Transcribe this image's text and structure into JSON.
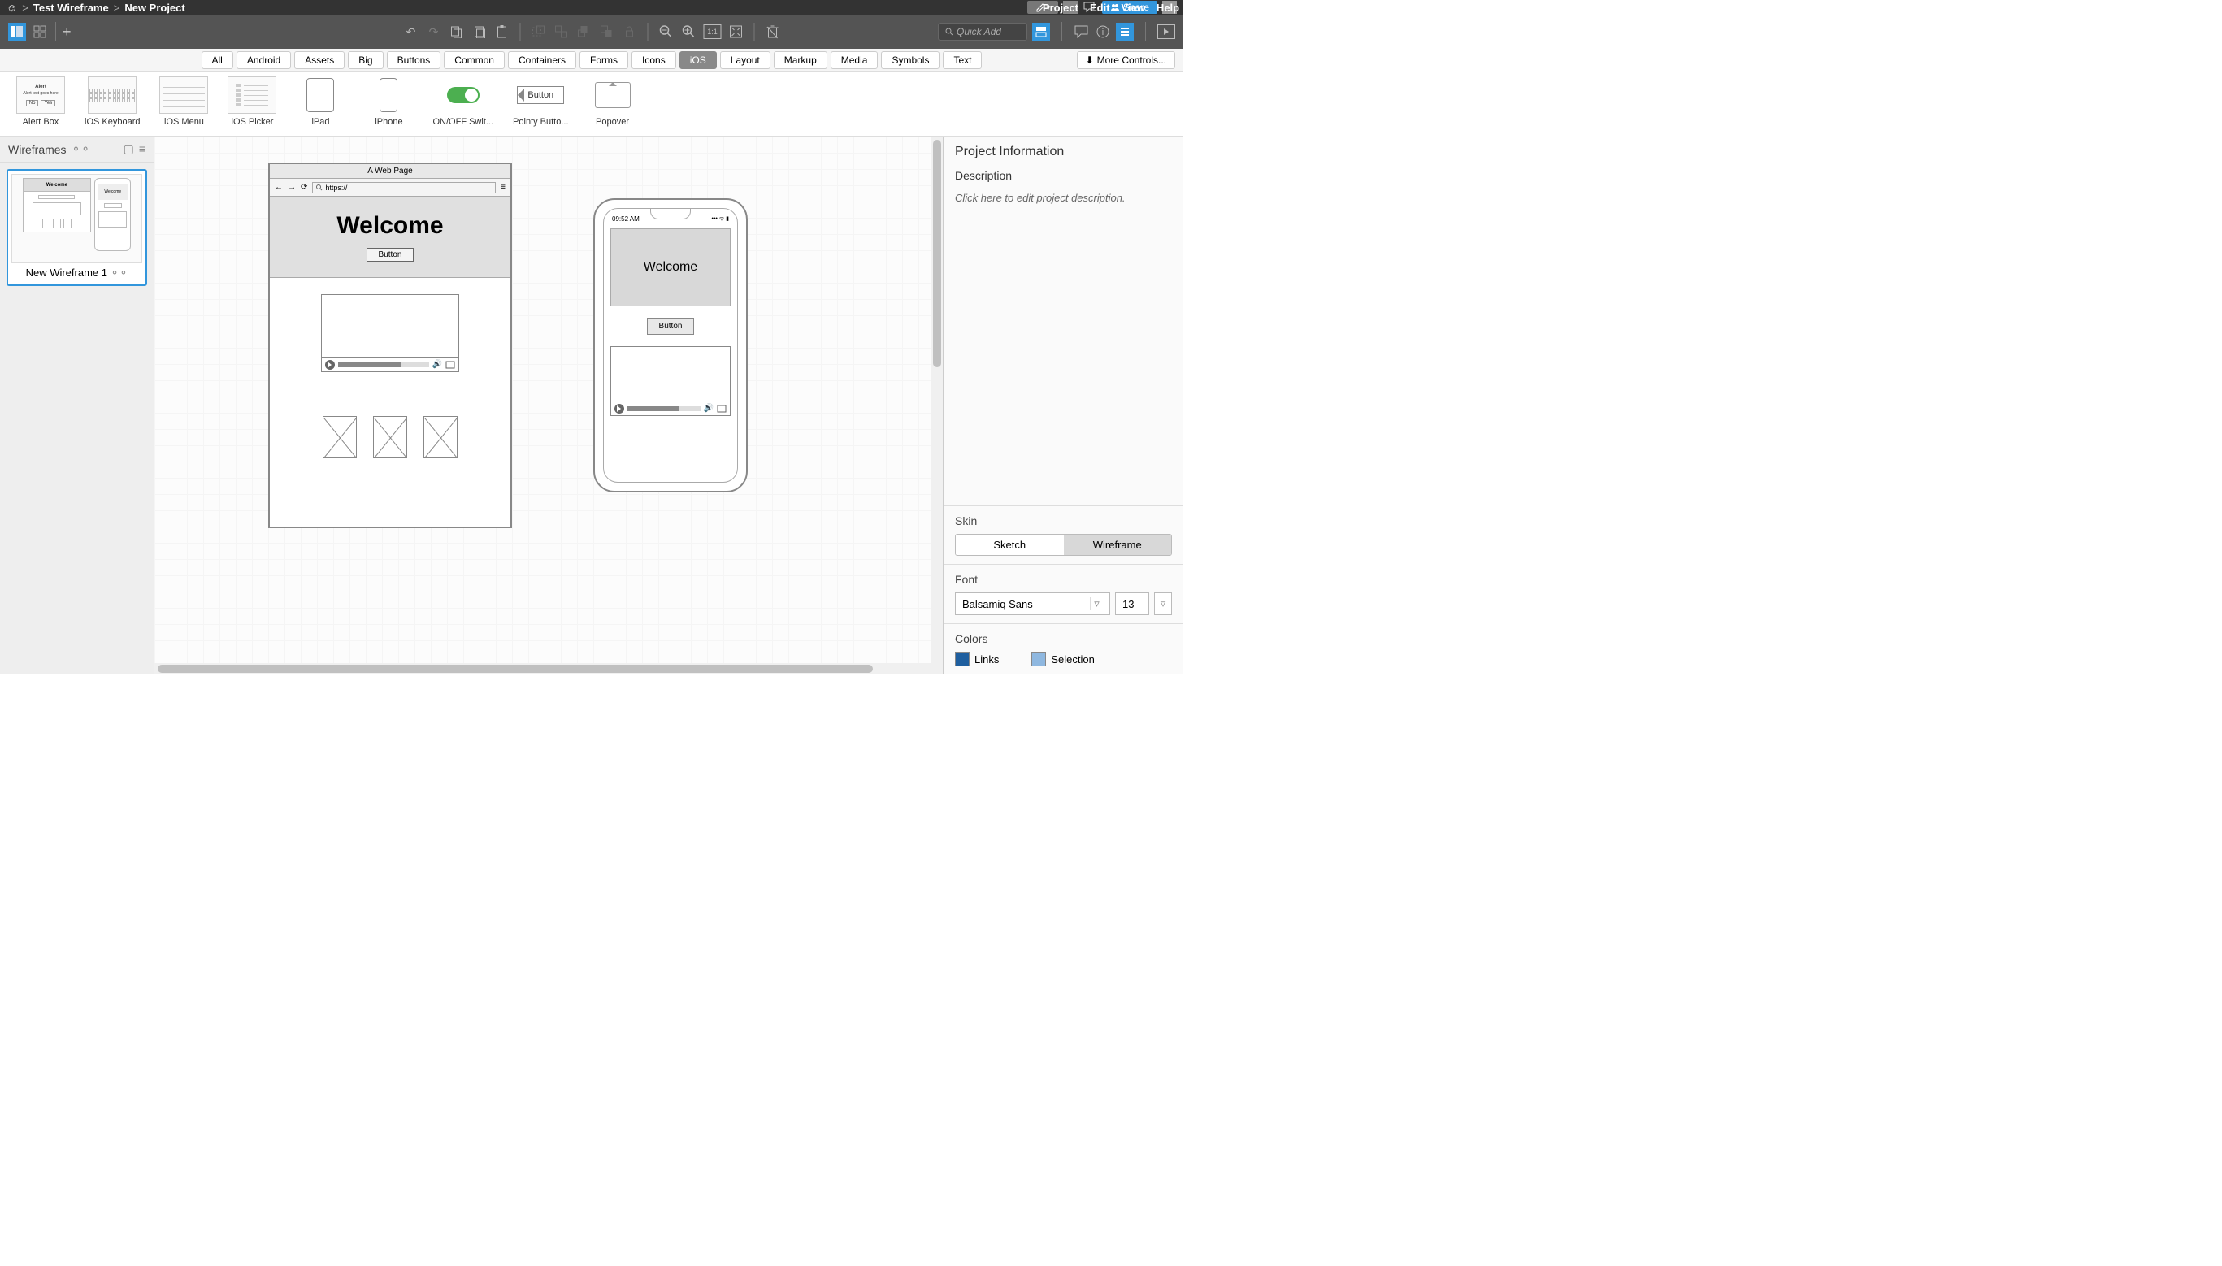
{
  "breadcrumb": {
    "project": "Test Wireframe",
    "page": "New Project"
  },
  "menu": {
    "project": "Project",
    "edit": "Edit",
    "view": "View",
    "help": "Help"
  },
  "share_label": "Share",
  "quick_add_placeholder": "Quick Add",
  "categories": [
    "All",
    "Android",
    "Assets",
    "Big",
    "Buttons",
    "Common",
    "Containers",
    "Forms",
    "Icons",
    "iOS",
    "Layout",
    "Markup",
    "Media",
    "Symbols",
    "Text"
  ],
  "active_category": "iOS",
  "more_controls": "More Controls...",
  "components": [
    {
      "name": "Alert Box"
    },
    {
      "name": "iOS Keyboard"
    },
    {
      "name": "iOS Menu"
    },
    {
      "name": "iOS Picker"
    },
    {
      "name": "iPad"
    },
    {
      "name": "iPhone"
    },
    {
      "name": "ON/OFF Swit..."
    },
    {
      "name": "Pointy Butto..."
    },
    {
      "name": "Popover"
    }
  ],
  "pointy_button_label": "Button",
  "left_panel": {
    "title": "Wireframes",
    "thumb_name": "New Wireframe 1",
    "thumb_welcome": "Welcome"
  },
  "canvas": {
    "browser": {
      "title": "A Web Page",
      "url": "https://",
      "heading": "Welcome",
      "button": "Button"
    },
    "phone": {
      "time": "09:52 AM",
      "heading": "Welcome",
      "button": "Button"
    }
  },
  "right_panel": {
    "title": "Project Information",
    "desc_label": "Description",
    "desc_placeholder": "Click here to edit project description.",
    "skin_label": "Skin",
    "skin_options": [
      "Sketch",
      "Wireframe"
    ],
    "skin_active": "Wireframe",
    "font_label": "Font",
    "font_name": "Balsamiq Sans",
    "font_size": "13",
    "colors_label": "Colors",
    "links_label": "Links",
    "selection_label": "Selection",
    "links_color": "#1f5f9f",
    "selection_color": "#8fb8e0"
  }
}
